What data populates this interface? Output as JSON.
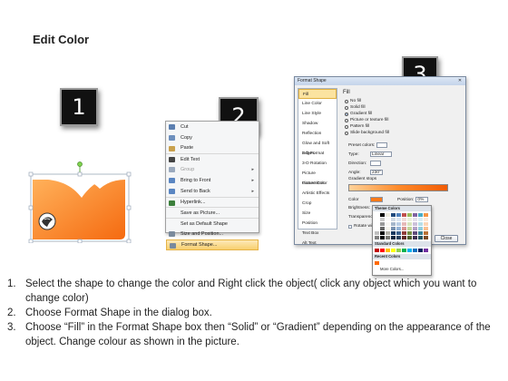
{
  "title": "Edit Color",
  "badges": [
    "1",
    "2",
    "3"
  ],
  "context_menu": [
    {
      "label": "Cut",
      "icon": "scissors-icon",
      "color": "#5b7fb0"
    },
    {
      "label": "Copy",
      "icon": "copy-icon",
      "color": "#6d8fbd"
    },
    {
      "label": "Paste",
      "icon": "paste-icon",
      "color": "#c9a14d"
    },
    {
      "label": "Edit Text",
      "icon": "text-icon",
      "color": "#444444",
      "sep": true
    },
    {
      "label": "Group",
      "icon": "group-icon",
      "color": "#9aa9bd",
      "arrow": "▸",
      "dim": true
    },
    {
      "label": "Bring to Front",
      "icon": "bring-front-icon",
      "color": "#5a86c2",
      "arrow": "▸"
    },
    {
      "label": "Send to Back",
      "icon": "send-back-icon",
      "color": "#5a86c2",
      "arrow": "▸"
    },
    {
      "label": "Hyperlink...",
      "icon": "link-icon",
      "color": "#3b7f3b",
      "sep": true
    },
    {
      "label": "Save as Picture...",
      "icon": "",
      "color": "",
      "sep": true
    },
    {
      "label": "Set as Default Shape",
      "icon": "",
      "color": "",
      "sep": true
    },
    {
      "label": "Size and Position...",
      "icon": "size-icon",
      "color": "#7a8a9c"
    },
    {
      "label": "Format Shape...",
      "icon": "format-shape-icon",
      "color": "#7a8a9c",
      "highlight": true
    }
  ],
  "dialog": {
    "title": "Format Shape",
    "close_glyph": "✕",
    "nav": [
      "Fill",
      "Line Color",
      "Line Style",
      "Shadow",
      "Reflection",
      "Glow and Soft Edges",
      "3-D Format",
      "3-D Rotation",
      "Picture Corrections",
      "Picture Color",
      "Artistic Effects",
      "Crop",
      "Size",
      "Position",
      "Text Box",
      "Alt Text"
    ],
    "section": "Fill",
    "options": [
      "No fill",
      "Solid fill",
      "Gradient fill",
      "Picture or texture fill",
      "Pattern fill",
      "Slide background fill"
    ],
    "preset_label": "Preset colors:",
    "type_label": "Type:",
    "type_value": "Linear",
    "direction_label": "Direction:",
    "angle_label": "Angle:",
    "angle_value": "230°",
    "stops_label": "Gradient stops",
    "color_label": "Color",
    "position_label": "Position:",
    "position_value": "0%",
    "brightness_label": "Brightness:",
    "transparency_label": "Transparency:",
    "rotate_label": "Rotate with shape",
    "close_label": "Close"
  },
  "palette": {
    "theme_label": "Theme Colors",
    "standard_label": "Standard Colors",
    "recent_label": "Recent Colors",
    "more_label": "More Colors...",
    "theme_top": [
      "#ffffff",
      "#000000",
      "#eeece1",
      "#1f497d",
      "#4f81bd",
      "#c0504d",
      "#9bbb59",
      "#8064a2",
      "#4bacc6",
      "#f79646"
    ],
    "standard": [
      "#c00000",
      "#ff0000",
      "#ffc000",
      "#ffff00",
      "#92d050",
      "#00b050",
      "#00b0f0",
      "#0070c0",
      "#002060",
      "#7030a0"
    ],
    "recent": [
      "#ff6a00"
    ]
  },
  "steps": [
    {
      "n": "1.",
      "text": "Select the shape to change the color and Right click the object( click any object which you want to change color)"
    },
    {
      "n": "2.",
      "text": "Choose Format Shape in the dialog box."
    },
    {
      "n": "3.",
      "text": "Choose “Fill” in the Format Shape box then “Solid” or “Gradient” depending on the appearance of the object. Change colour as shown in the picture."
    }
  ]
}
